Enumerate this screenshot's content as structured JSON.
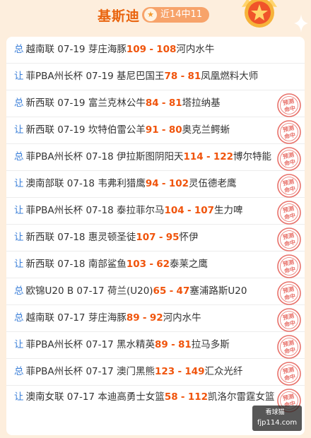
{
  "header": {
    "title": "基斯迪",
    "badge_icon": "star-icon",
    "badge_text": "近14中11"
  },
  "records": [
    {
      "tag": "总",
      "league": "越南联",
      "date": "07-19",
      "home": "芽庄海豚",
      "home_score": "109",
      "sep": "-",
      "away_score": "108",
      "away": "河内水牛",
      "hit": false
    },
    {
      "tag": "让",
      "league": "菲PBA州长杯",
      "date": "07-19",
      "home": "基尼巴国王",
      "home_score": "78",
      "sep": "-",
      "away_score": "81",
      "away": "凤凰燃料大师",
      "hit": false
    },
    {
      "tag": "总",
      "league": "新西联",
      "date": "07-19",
      "home": "富兰克林公牛",
      "home_score": "84",
      "sep": "-",
      "away_score": "81",
      "away": "塔拉纳基",
      "hit": true
    },
    {
      "tag": "让",
      "league": "新西联",
      "date": "07-19",
      "home": "坎特伯雷公羊",
      "home_score": "91",
      "sep": "-",
      "away_score": "80",
      "away": "奥克兰鳄蜥",
      "hit": true
    },
    {
      "tag": "总",
      "league": "菲PBA州长杯",
      "date": "07-18",
      "home": "伊拉斯图阴阳天",
      "home_score": "114",
      "sep": "-",
      "away_score": "122",
      "away": "博尔特能",
      "hit": true
    },
    {
      "tag": "让",
      "league": "澳南部联",
      "date": "07-18",
      "home": "韦弗利猎鹰",
      "home_score": "94",
      "sep": "-",
      "away_score": "102",
      "away": "灵伍德老鹰",
      "hit": true
    },
    {
      "tag": "让",
      "league": "菲PBA州长杯",
      "date": "07-18",
      "home": "泰拉菲尔马",
      "home_score": "104",
      "sep": "-",
      "away_score": "107",
      "away": "生力啤",
      "hit": true
    },
    {
      "tag": "让",
      "league": "新西联",
      "date": "07-18",
      "home": "惠灵顿圣徒",
      "home_score": "107",
      "sep": "-",
      "away_score": "95",
      "away": "怀伊",
      "hit": true
    },
    {
      "tag": "让",
      "league": "新西联",
      "date": "07-18",
      "home": "南部鲨鱼",
      "home_score": "103",
      "sep": "-",
      "away_score": "62",
      "away": "泰莱之鹰",
      "hit": true
    },
    {
      "tag": "总",
      "league": "欧锦U20 B",
      "date": "07-17",
      "home": "荷兰(U20)",
      "home_score": "65",
      "sep": "-",
      "away_score": "47",
      "away": "塞浦路斯U20",
      "hit": true
    },
    {
      "tag": "总",
      "league": "越南联",
      "date": "07-17",
      "home": "芽庄海豚",
      "home_score": "89",
      "sep": "-",
      "away_score": "92",
      "away": "河内水牛",
      "hit": true
    },
    {
      "tag": "让",
      "league": "菲PBA州长杯",
      "date": "07-17",
      "home": "黑水精英",
      "home_score": "89",
      "sep": "-",
      "away_score": "81",
      "away": "拉马多斯",
      "hit": true
    },
    {
      "tag": "总",
      "league": "菲PBA州长杯",
      "date": "07-17",
      "home": "澳门黑熊",
      "home_score": "123",
      "sep": "-",
      "away_score": "149",
      "away": "汇众光纤",
      "hit": true
    },
    {
      "tag": "让",
      "league": "澳南女联",
      "date": "07-17",
      "home": "本迪高勇士女篮",
      "home_score": "58",
      "sep": "-",
      "away_score": "112",
      "away": "凯洛尔雷霆女篮",
      "hit": true
    }
  ],
  "stamp_text": "预测命中",
  "watermark": {
    "logo": "看球猫",
    "text": "fjp114.com"
  },
  "colors": {
    "accent": "#e9640e",
    "score": "#f0540c",
    "tag": "#3b7fd8",
    "stamp": "#e8716a",
    "badge": "#f7a36a"
  }
}
